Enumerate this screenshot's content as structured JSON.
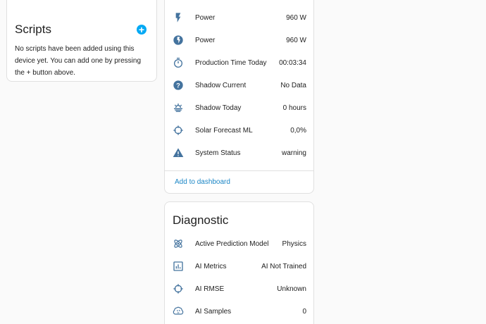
{
  "scripts": {
    "title": "Scripts",
    "description": "No scripts have been added using this device yet. You can add one by pressing the + button above.",
    "add_icon": "plus-circle-icon"
  },
  "entities": {
    "rows": [
      {
        "label": "Power",
        "value": "960 W",
        "icon": "flash-icon"
      },
      {
        "label": "Power",
        "value": "960 W",
        "icon": "flash-circle-icon"
      },
      {
        "label": "Production Time Today",
        "value": "00:03:34",
        "icon": "timer-icon"
      },
      {
        "label": "Shadow Current",
        "value": "No Data",
        "icon": "help-circle-icon"
      },
      {
        "label": "Shadow Today",
        "value": "0 hours",
        "icon": "weather-hazy-icon"
      },
      {
        "label": "Solar Forecast ML",
        "value": "0,0%",
        "icon": "crosshairs-icon"
      },
      {
        "label": "System Status",
        "value": "warning",
        "icon": "alert-icon"
      }
    ],
    "action": "Add to dashboard"
  },
  "diagnostic": {
    "title": "Diagnostic",
    "rows": [
      {
        "label": "Active Prediction Model",
        "value": "Physics",
        "icon": "atom-icon"
      },
      {
        "label": "AI Metrics",
        "value": "AI Not Trained",
        "icon": "chart-box-icon"
      },
      {
        "label": "AI RMSE",
        "value": "Unknown",
        "icon": "crosshairs-icon"
      },
      {
        "label": "AI Samples",
        "value": "0",
        "icon": "brain-icon"
      }
    ]
  },
  "colors": {
    "icon": "#44739e",
    "accent": "#03a9f4",
    "link": "#1b86c6"
  }
}
